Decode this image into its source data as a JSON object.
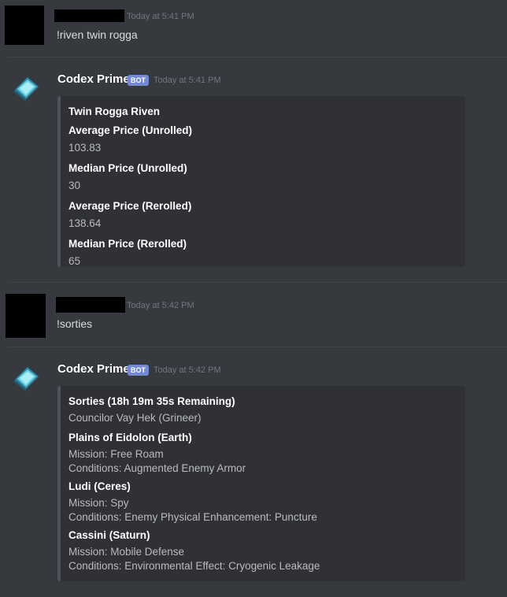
{
  "messages": [
    {
      "timestamp": "Today at 5:41 PM",
      "text": "!riven twin rogga"
    },
    {
      "username": "Codex Prime",
      "badge": "BOT",
      "timestamp": "Today at 5:41 PM",
      "embed": {
        "title": "Twin Rogga Riven",
        "fields": [
          {
            "name": "Average Price (Unrolled)",
            "value": "103.83"
          },
          {
            "name": "Median Price (Unrolled)",
            "value": "30"
          },
          {
            "name": "Average Price (Rerolled)",
            "value": "138.64"
          },
          {
            "name": "Median Price (Rerolled)",
            "value": "65"
          }
        ]
      }
    },
    {
      "timestamp": "Today at 5:42 PM",
      "text": "!sorties"
    },
    {
      "username": "Codex Prime",
      "badge": "BOT",
      "timestamp": "Today at 5:42 PM",
      "embed": {
        "title": "Sorties (18h 19m 35s Remaining)",
        "subtitle": "Councilor Vay Hek (Grineer)",
        "missions": [
          {
            "name": "Plains of Eidolon (Earth)",
            "mission": "Mission: Free Roam",
            "conditions": "Conditions: Augmented Enemy Armor"
          },
          {
            "name": "Ludi (Ceres)",
            "mission": "Mission: Spy",
            "conditions": "Conditions: Enemy Physical Enhancement: Puncture"
          },
          {
            "name": "Cassini (Saturn)",
            "mission": "Mission: Mobile Defense",
            "conditions": "Conditions: Environmental Effect: Cryogenic Leakage"
          }
        ]
      }
    }
  ],
  "colors": {
    "background": "#36393e",
    "embed_bg": "#2f3136",
    "embed_border": "#4f545c",
    "bot_badge": "#7289da",
    "timestamp": "#72767d"
  },
  "icons": {
    "bot_avatar": "codex-crystal-book-icon"
  }
}
